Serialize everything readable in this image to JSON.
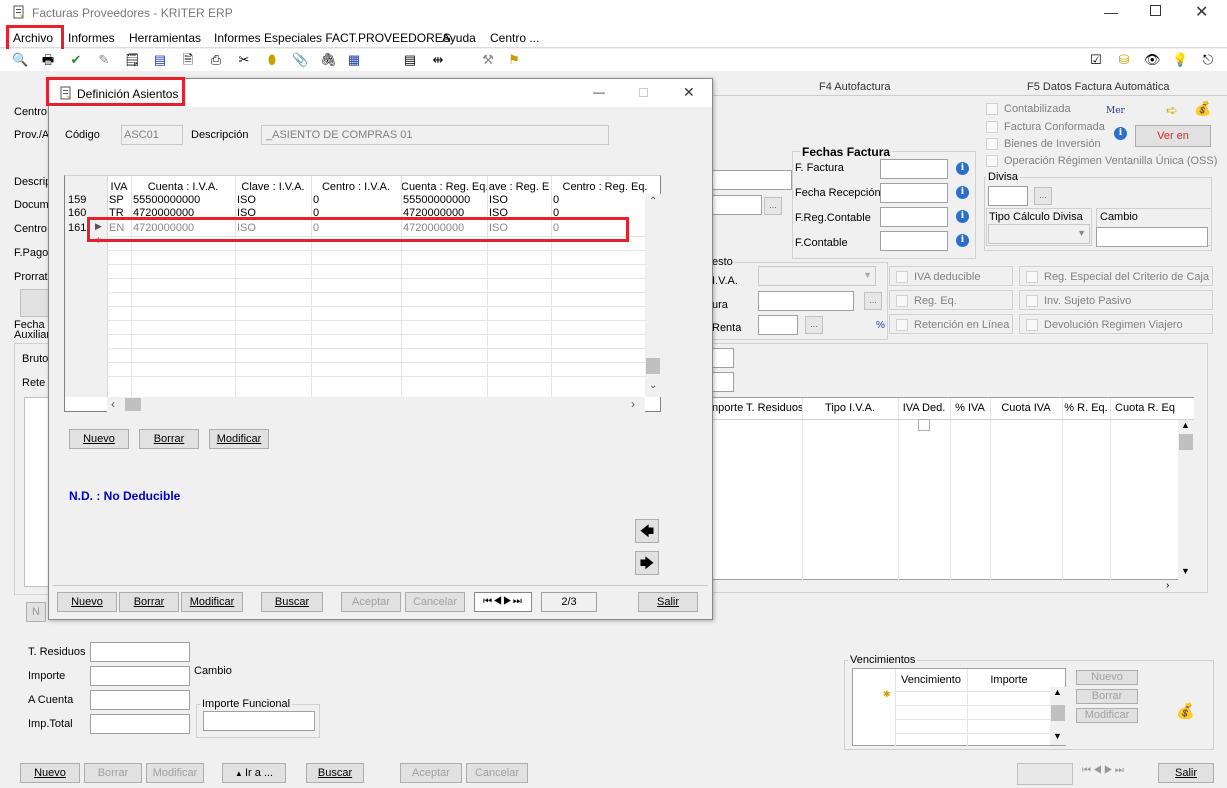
{
  "window": {
    "title": "Facturas Proveedores  - KRITER ERP"
  },
  "menu": {
    "items": [
      "Archivo",
      "Informes",
      "Herramientas",
      "Informes Especiales FACT.PROVEEDORES",
      "Ayuda",
      "Centro ..."
    ]
  },
  "tabs": {
    "f4": "F4 Autofactura",
    "f5": "F5 Datos Factura Automática"
  },
  "main": {
    "left_labels": [
      "Centro",
      "Prov./A",
      "Descrip",
      "Docum",
      "Centro",
      "F.Pago",
      "Prorrat",
      "Fecha",
      "Auxiliar",
      "Bruto",
      "Rete"
    ],
    "checkboxes_top": [
      {
        "label": "Contabilizada",
        "checked": false
      },
      {
        "label": "Factura Conformada",
        "checked": false
      },
      {
        "label": "Bienes de Inversión",
        "checked": false
      },
      {
        "label": "Operación Régimen Ventanilla Única (OSS)",
        "checked": false
      }
    ],
    "mer_label": "Mer",
    "ver_en": "Ver en",
    "fechas_factura": {
      "title": "Fechas Factura",
      "labels": [
        "F. Factura",
        "Fecha Recepción",
        "F.Reg.Contable",
        "F.Contable"
      ]
    },
    "divisa": {
      "label": "Divisa",
      "tipo_calculo": "Tipo Cálculo Divisa",
      "cambio": "Cambio"
    },
    "impuesto_labels": [
      "esto",
      "I.V.A.",
      "ura",
      "Renta"
    ],
    "percent_sign": "%",
    "checkboxes_mid": [
      {
        "label": "IVA deducible",
        "checked": false
      },
      {
        "label": "Reg. Especial del Criterio de Caja",
        "checked": false
      },
      {
        "label": "Reg. Eq.",
        "checked": false
      },
      {
        "label": "Inv. Sujeto Pasivo",
        "checked": false
      },
      {
        "label": "Retención en Línea",
        "checked": false
      },
      {
        "label": "Devolución Regimen Viajero",
        "checked": false
      }
    ],
    "tax_grid_headers": [
      "nporte T. Residuos",
      "Tipo I.V.A.",
      "IVA Ded.",
      "% IVA",
      "Cuota IVA",
      "% R. Eq.",
      "Cuota R. Eq"
    ],
    "totals": {
      "t_residuos": "T. Residuos",
      "importe": "Importe",
      "a_cuenta": "A Cuenta",
      "imp_total": "Imp.Total",
      "cambio": "Cambio",
      "importe_funcional": "Importe Funcional"
    },
    "vencimientos": {
      "title": "Vencimientos",
      "headers": [
        "Vencimiento",
        "Importe"
      ],
      "buttons": [
        "Nuevo",
        "Borrar",
        "Modificar"
      ]
    },
    "bottom_buttons": [
      "Nuevo",
      "Borrar",
      "Modificar",
      "Ir a ...",
      "Buscar",
      "Aceptar",
      "Cancelar",
      "Salir"
    ],
    "partial_button": "N"
  },
  "dialog": {
    "title": "Definición Asientos",
    "codigo_label": "Código",
    "codigo_value": "ASC01",
    "descripcion_label": "Descripción",
    "descripcion_value": "_ASIENTO DE COMPRAS 01",
    "grid_headers": [
      "IVA",
      "Cuenta : I.V.A.",
      "Clave : I.V.A.",
      "Centro : I.V.A.",
      "Cuenta : Reg. Eq.",
      "ave : Reg. E",
      "Centro : Reg. Eq."
    ],
    "rows": [
      {
        "num": "159",
        "iva": "SP",
        "cuenta": "55500000000",
        "clave": "ISO",
        "centro": "0",
        "cuenta_req": "55500000000",
        "clave_req": "ISO",
        "centro_req": "0"
      },
      {
        "num": "160",
        "iva": "TR",
        "cuenta": "4720000000",
        "clave": "ISO",
        "centro": "0",
        "cuenta_req": "4720000000",
        "clave_req": "ISO",
        "centro_req": "0"
      },
      {
        "num": "161",
        "iva": "EN",
        "cuenta": "4720000000",
        "clave": "ISO",
        "centro": "0",
        "cuenta_req": "4720000000",
        "clave_req": "ISO",
        "centro_req": "0"
      }
    ],
    "grid_buttons": [
      "Nuevo",
      "Borrar",
      "Modificar"
    ],
    "nd_label": "N.D. : No Deducible",
    "bottom_buttons": [
      "Nuevo",
      "Borrar",
      "Modificar",
      "Buscar",
      "Aceptar",
      "Cancelar",
      "Salir"
    ],
    "page_indicator": "2/3"
  },
  "colors": {
    "highlight_red": "#e8202a",
    "nd_blue": "#0000c8",
    "ver_en_red": "#e8202a"
  }
}
